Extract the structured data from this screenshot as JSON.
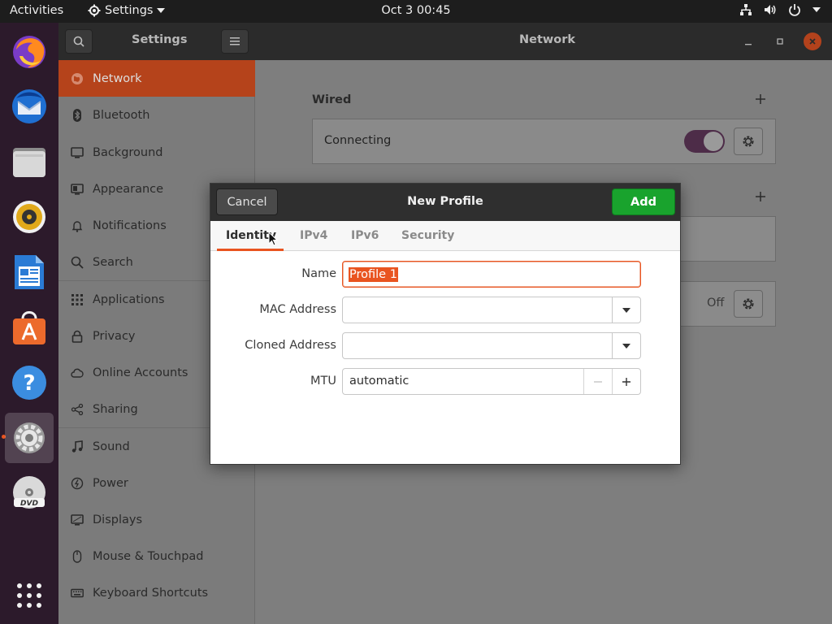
{
  "topbar": {
    "activities": "Activities",
    "app_menu": "Settings",
    "clock": "Oct 3  00:45"
  },
  "headerbar": {
    "left_title": "Settings",
    "main_title": "Network"
  },
  "sidebar": {
    "items": [
      {
        "label": "Network",
        "icon": "network-icon"
      },
      {
        "label": "Bluetooth",
        "icon": "bluetooth-icon"
      },
      {
        "label": "Background",
        "icon": "monitor-icon"
      },
      {
        "label": "Appearance",
        "icon": "appearance-icon"
      },
      {
        "label": "Notifications",
        "icon": "bell-icon"
      },
      {
        "label": "Search",
        "icon": "search-icon"
      },
      {
        "label": "Applications",
        "icon": "grid-icon"
      },
      {
        "label": "Privacy",
        "icon": "lock-icon"
      },
      {
        "label": "Online Accounts",
        "icon": "cloud-icon"
      },
      {
        "label": "Sharing",
        "icon": "share-icon"
      },
      {
        "label": "Sound",
        "icon": "music-icon"
      },
      {
        "label": "Power",
        "icon": "power-icon"
      },
      {
        "label": "Displays",
        "icon": "display-icon"
      },
      {
        "label": "Mouse & Touchpad",
        "icon": "mouse-icon"
      },
      {
        "label": "Keyboard Shortcuts",
        "icon": "keyboard-icon"
      }
    ]
  },
  "network": {
    "wired_title": "Wired",
    "wired_status": "Connecting",
    "vpn_status": "Off"
  },
  "dialog": {
    "cancel": "Cancel",
    "title": "New Profile",
    "add": "Add",
    "tabs": [
      "Identity",
      "IPv4",
      "IPv6",
      "Security"
    ],
    "name_label": "Name",
    "name_value": "Profile 1",
    "mac_label": "MAC Address",
    "mac_value": "",
    "cloned_label": "Cloned Address",
    "cloned_value": "",
    "mtu_label": "MTU",
    "mtu_value": "automatic"
  },
  "colors": {
    "accent": "#e95420",
    "add_button": "#19a32d",
    "dock_bg": "#2c1a2b",
    "topbar_bg": "#1d1d1d"
  }
}
